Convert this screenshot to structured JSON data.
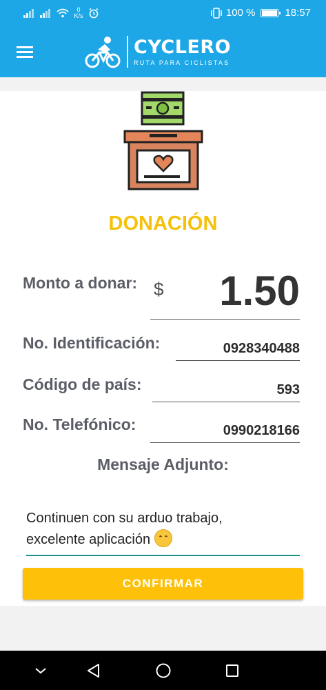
{
  "status_bar": {
    "speed_value": "0",
    "speed_unit": "K/s",
    "battery": "100 %",
    "time": "18:57"
  },
  "app_bar": {
    "logo_title": "CYCLERO",
    "logo_subtitle": "RUTA PARA CICLISTAS"
  },
  "donation": {
    "title": "DONACIÓN",
    "amount_label": "Monto a donar:",
    "currency_symbol": "$",
    "amount_value": "1.50",
    "id_label": "No. Identificación:",
    "id_value": "0928340488",
    "country_label": "Código de país:",
    "country_value": "593",
    "phone_label": "No. Telefónico:",
    "phone_value": "0990218166",
    "message_label": "Mensaje Adjunto:",
    "message_line1": "Continuen con su arduo trabajo,",
    "message_line2": "excelente aplicación",
    "confirm_label": "CONFIRMAR"
  },
  "colors": {
    "primary": "#1da7e6",
    "accent": "#fec009",
    "title": "#f5c10a",
    "input_underline": "#1c9187"
  },
  "icons": [
    "signal-icon",
    "wifi-icon",
    "alarm-icon",
    "vibrate-icon",
    "battery-icon",
    "menu-icon",
    "cyclist-icon",
    "donation-box-icon",
    "smiling-hug-emoji",
    "back-icon",
    "home-icon",
    "recents-icon",
    "hide-keyboard-icon"
  ]
}
